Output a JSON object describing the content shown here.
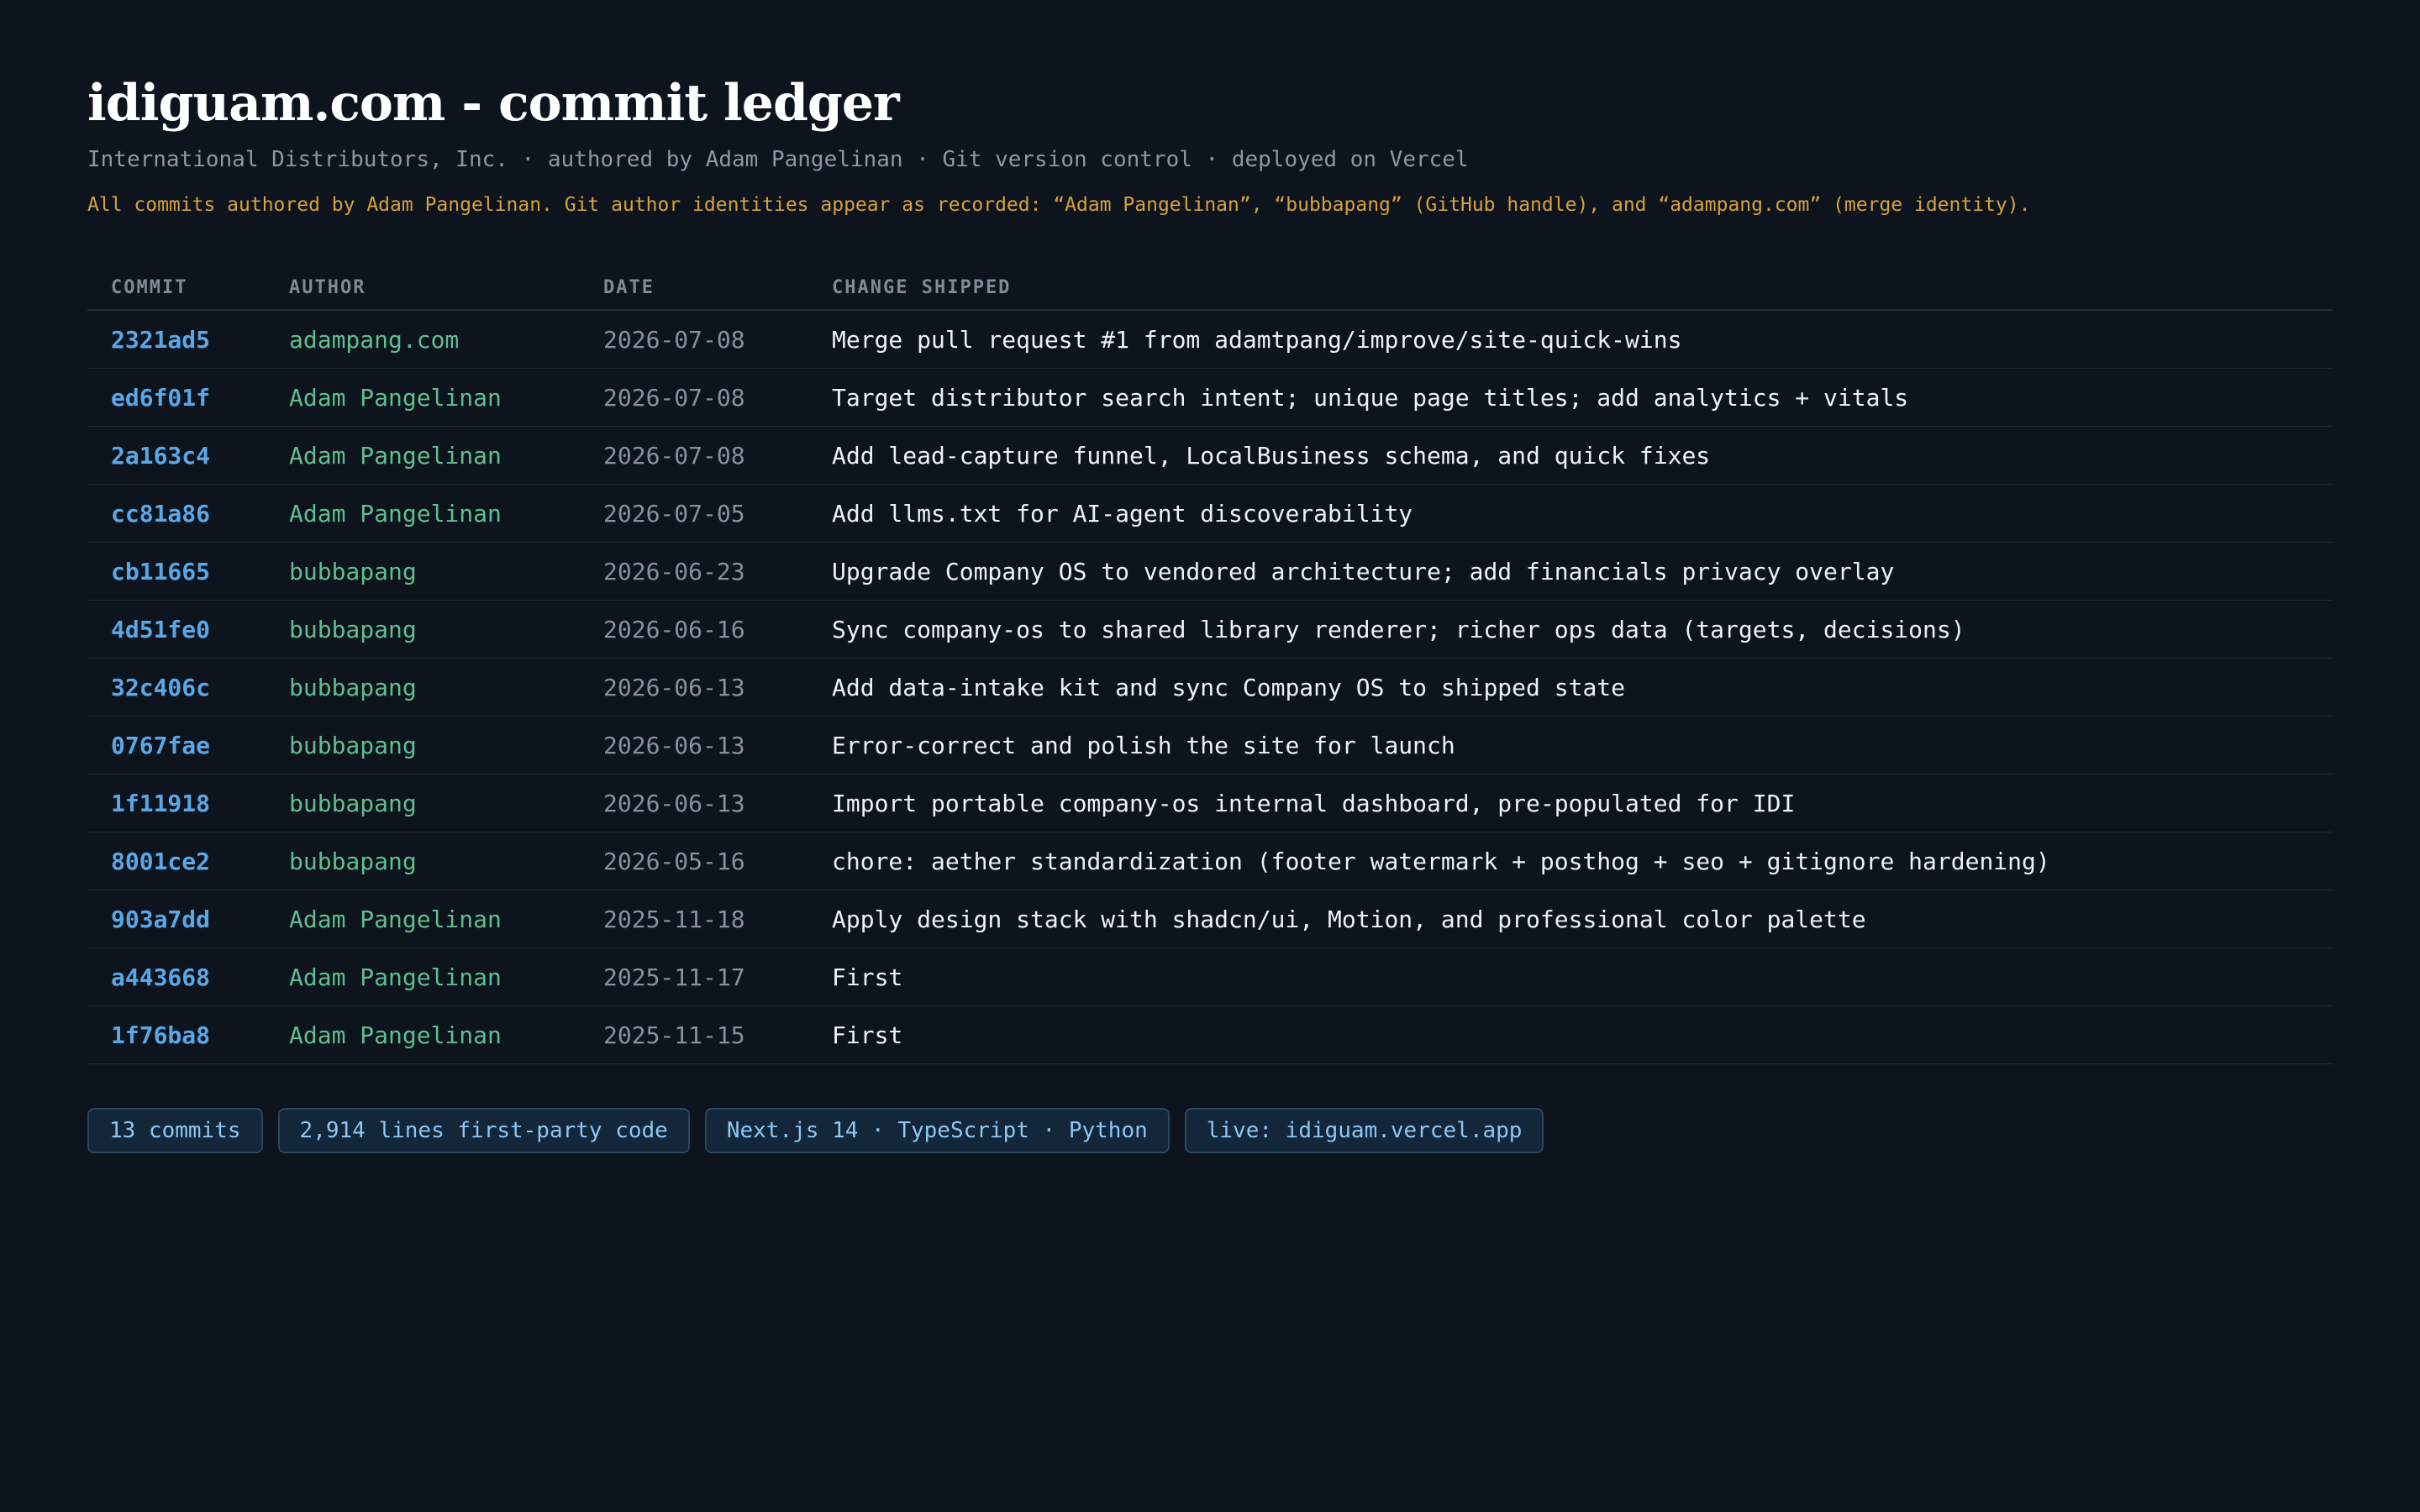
{
  "header": {
    "title": "idiguam.com - commit ledger",
    "subtitle": "International Distributors, Inc. · authored by Adam Pangelinan · Git version control · deployed on Vercel",
    "note": "All commits authored by Adam Pangelinan. Git author identities appear as recorded: “Adam Pangelinan”, “bubbapang” (GitHub handle), and “adampang.com” (merge identity)."
  },
  "table": {
    "columns": [
      "COMMIT",
      "AUTHOR",
      "DATE",
      "CHANGE SHIPPED"
    ],
    "rows": [
      {
        "commit": "2321ad5",
        "author": "adampang.com",
        "date": "2026-07-08",
        "change": "Merge pull request #1 from adamtpang/improve/site-quick-wins"
      },
      {
        "commit": "ed6f01f",
        "author": "Adam Pangelinan",
        "date": "2026-07-08",
        "change": "Target distributor search intent; unique page titles; add analytics + vitals"
      },
      {
        "commit": "2a163c4",
        "author": "Adam Pangelinan",
        "date": "2026-07-08",
        "change": "Add lead-capture funnel, LocalBusiness schema, and quick fixes"
      },
      {
        "commit": "cc81a86",
        "author": "Adam Pangelinan",
        "date": "2026-07-05",
        "change": "Add llms.txt for AI-agent discoverability"
      },
      {
        "commit": "cb11665",
        "author": "bubbapang",
        "date": "2026-06-23",
        "change": "Upgrade Company OS to vendored architecture; add financials privacy overlay"
      },
      {
        "commit": "4d51fe0",
        "author": "bubbapang",
        "date": "2026-06-16",
        "change": "Sync company-os to shared library renderer; richer ops data (targets, decisions)"
      },
      {
        "commit": "32c406c",
        "author": "bubbapang",
        "date": "2026-06-13",
        "change": "Add data-intake kit and sync Company OS to shipped state"
      },
      {
        "commit": "0767fae",
        "author": "bubbapang",
        "date": "2026-06-13",
        "change": "Error-correct and polish the site for launch"
      },
      {
        "commit": "1f11918",
        "author": "bubbapang",
        "date": "2026-06-13",
        "change": "Import portable company-os internal dashboard, pre-populated for IDI"
      },
      {
        "commit": "8001ce2",
        "author": "bubbapang",
        "date": "2026-05-16",
        "change": "chore: aether standardization (footer watermark + posthog + seo + gitignore hardening)"
      },
      {
        "commit": "903a7dd",
        "author": "Adam Pangelinan",
        "date": "2025-11-18",
        "change": "Apply design stack with shadcn/ui, Motion, and professional color palette"
      },
      {
        "commit": "a443668",
        "author": "Adam Pangelinan",
        "date": "2025-11-17",
        "change": "First"
      },
      {
        "commit": "1f76ba8",
        "author": "Adam Pangelinan",
        "date": "2025-11-15",
        "change": "First"
      }
    ]
  },
  "summary": {
    "commits": "13 commits",
    "lines": "2,914 lines first-party code",
    "stack": "Next.js 14 · TypeScript · Python",
    "live": "live: idiguam.vercel.app"
  },
  "colors": {
    "background": "#0e141d",
    "commit_hash": "#5aa7e8",
    "author": "#5fbf8e",
    "note": "#d6a13e"
  }
}
